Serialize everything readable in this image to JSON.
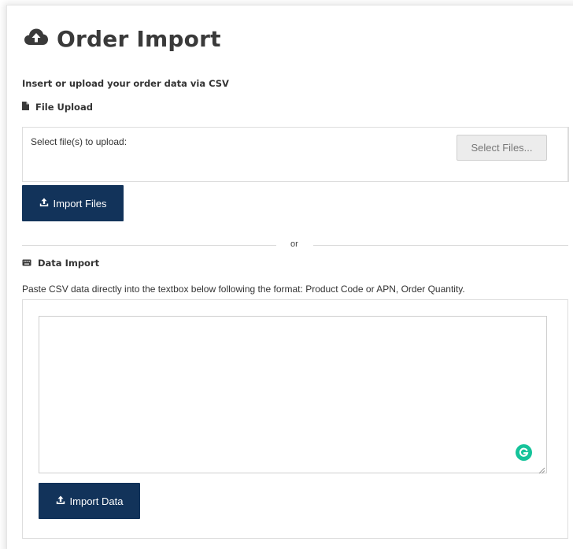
{
  "page": {
    "title": "Order Import",
    "title_icon": "cloud-upload-icon"
  },
  "intro": {
    "subheading": "Insert or upload your order data via CSV"
  },
  "file_upload": {
    "heading": "File Upload",
    "heading_icon": "file-icon",
    "prompt": "Select file(s) to upload:",
    "select_button": "Select Files...",
    "import_button": "Import Files",
    "import_icon": "upload-icon"
  },
  "divider": {
    "label": "or"
  },
  "data_import": {
    "heading": "Data Import",
    "heading_icon": "keyboard-icon",
    "instructions": "Paste CSV data directly into the textbox below following the format: Product Code or APN, Order Quantity.",
    "textarea_value": "",
    "import_button": "Import Data",
    "import_icon": "upload-icon",
    "assistant_badge": "grammarly-icon"
  },
  "colors": {
    "primary": "#12335a",
    "border": "#dddddd",
    "grammarly": "#15c39a"
  }
}
